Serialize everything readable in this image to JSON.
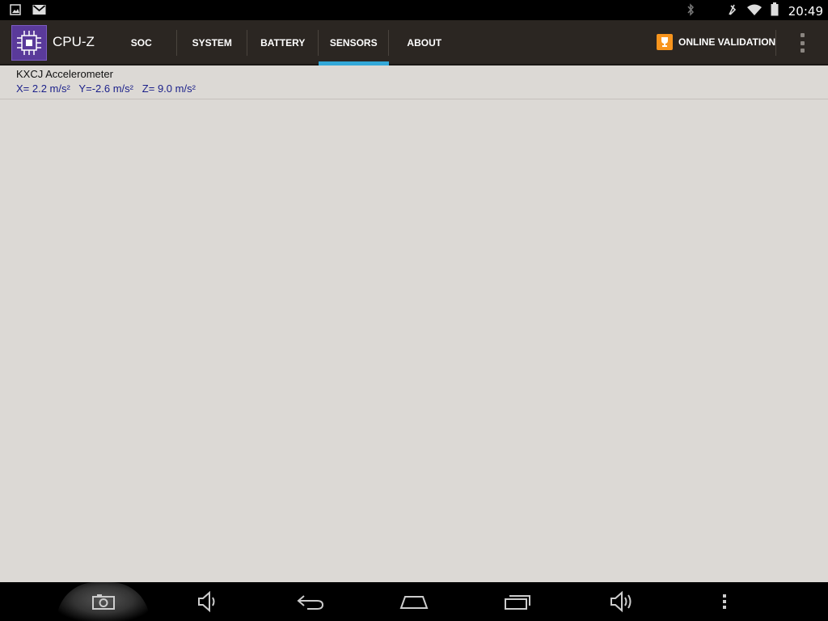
{
  "status_bar": {
    "time": "20:49",
    "left_icons": [
      "gallery-icon",
      "gmail-icon"
    ],
    "right_icons": [
      "bluetooth-icon",
      "vibrate-off-icon",
      "wifi-icon",
      "battery-icon"
    ]
  },
  "app": {
    "title": "CPU-Z",
    "logo_icon": "cpu-chip-icon"
  },
  "tabs": [
    {
      "label": "SOC",
      "active": false
    },
    {
      "label": "SYSTEM",
      "active": false
    },
    {
      "label": "BATTERY",
      "active": false
    },
    {
      "label": "SENSORS",
      "active": true
    },
    {
      "label": "ABOUT",
      "active": false
    }
  ],
  "actions": {
    "validation_label": "ONLINE VALIDATION",
    "validation_icon": "trophy-icon",
    "overflow_icon": "overflow-menu-icon"
  },
  "sensors": [
    {
      "name": "KXCJ Accelerometer",
      "values": "X= 2.2 m/s²   Y=-2.6 m/s²   Z= 9.0 m/s²"
    }
  ],
  "nav_bar": {
    "buttons": [
      "screenshot-icon",
      "volume-down-icon",
      "back-icon",
      "home-icon",
      "recent-apps-icon",
      "volume-up-icon",
      "menu-icon"
    ]
  },
  "colors": {
    "accent_tab": "#33a8d8",
    "action_bar": "#2b2622",
    "logo_bg": "#5a3a9a",
    "validation_orange": "#f7941d",
    "sensor_value_text": "#1a1f8a",
    "content_bg": "#dcd9d5"
  }
}
